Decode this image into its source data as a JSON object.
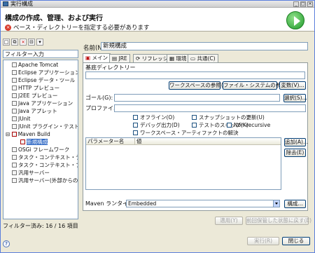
{
  "window": {
    "title": "実行構成"
  },
  "header": {
    "title": "構成の作成、管理、および実行",
    "error": "ベース・ディレクトリーを指定する必要があります"
  },
  "left": {
    "filter_placeholder": "フィルター入力",
    "tree": [
      {
        "label": "Apache Tomcat"
      },
      {
        "label": "Eclipse アプリケーション"
      },
      {
        "label": "Eclipse データ・ツール"
      },
      {
        "label": "HTTP プレビュー"
      },
      {
        "label": "J2EE プレビュー"
      },
      {
        "label": "Java アプリケーション"
      },
      {
        "label": "Java アプレット"
      },
      {
        "label": "JUnit"
      },
      {
        "label": "JUnit プラグイン・テスト"
      },
      {
        "label": "Maven Build"
      },
      {
        "label": "新規構成"
      },
      {
        "label": "OSGi フレームワーク"
      },
      {
        "label": "タスク・コンテキスト・テスト"
      },
      {
        "label": "タスク・コンテキスト・プラグイン"
      },
      {
        "label": "汎用サーバー"
      },
      {
        "label": "汎用サーバー(外部からの起"
      }
    ],
    "footer": "フィルター済み: 16 / 16 項目"
  },
  "right": {
    "name_label": "名前(N):",
    "name_value": "新規構成",
    "tabs": [
      {
        "label": "メイン"
      },
      {
        "label": "JRE"
      },
      {
        "label": "リフレッシュ"
      },
      {
        "label": "環境"
      },
      {
        "label": "共通(C)"
      }
    ],
    "base_dir_label": "基底ディレクトリー",
    "btn_workspace": "ワークスペースの参照(W)...",
    "btn_filesystem": "ファイル・システムの参照(L)...",
    "btn_vars": "変数(V)...",
    "goal_label": "ゴール(G):",
    "profile_label": "プロファイル(P):",
    "btn_select": "選択(S)...",
    "checks": {
      "offline": "オフライン(O)",
      "update_snapshots": "スナップショットの更新(U)",
      "debug": "デバッグ出力(D)",
      "skip_tests": "テストのスキップ(K)",
      "non_recursive": "Non-recursive",
      "resolve_ws": "ワークスペース・アーティファクトの解決"
    },
    "table_headers": [
      "パラメーター名",
      "値"
    ],
    "btn_add": "追加(A)...",
    "btn_remove": "除去(E)",
    "runtime_label": "Maven ランタイム(I):",
    "runtime_value": "Embedded",
    "btn_config": "構成...",
    "btn_apply": "適用(Y)",
    "btn_revert": "前回保管した状態に戻す(E)",
    "btn_run": "実行(R)",
    "btn_close": "閉じる"
  }
}
